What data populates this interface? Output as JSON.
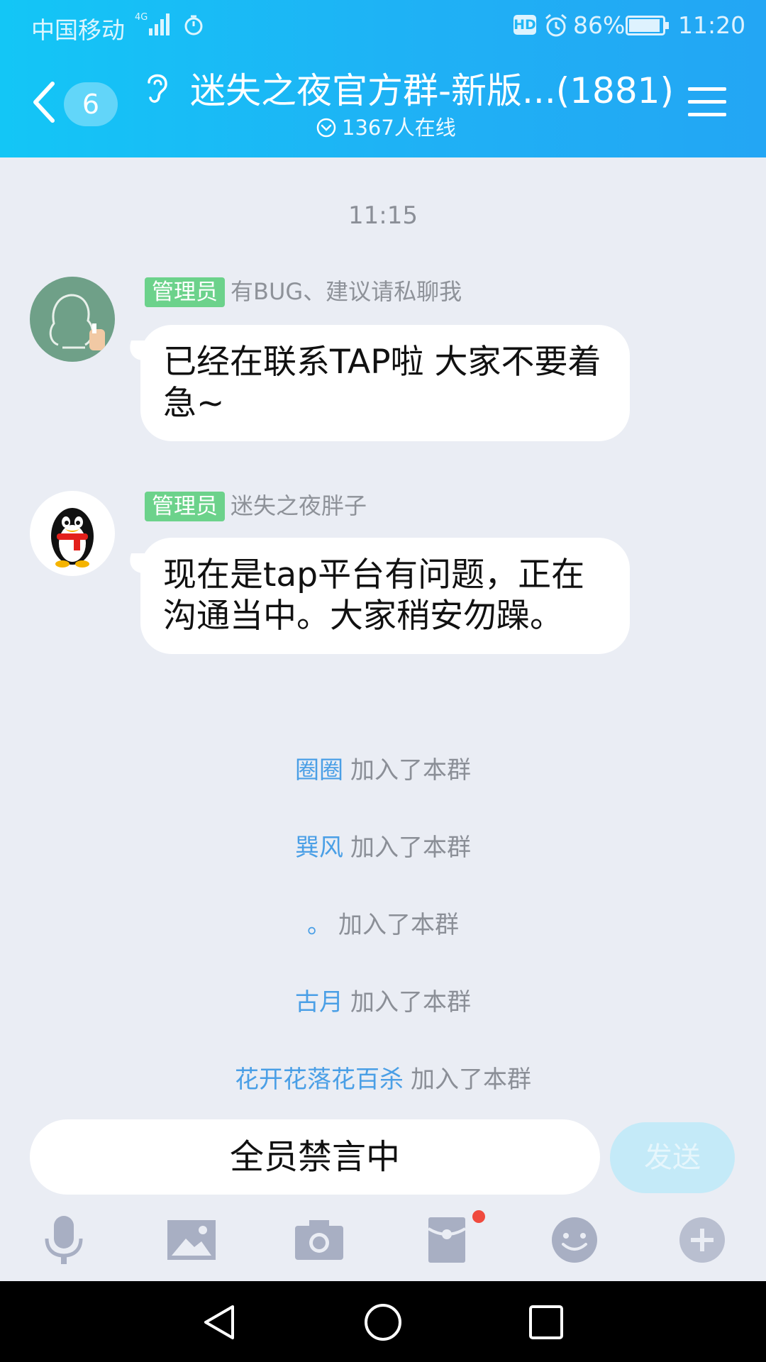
{
  "status_bar": {
    "carrier": "中国移动",
    "network": "4G",
    "hd": "HD",
    "battery": "86%",
    "time": "11:20"
  },
  "header": {
    "unread_count": "6",
    "title": "迷失之夜官方群-新版...(1881)",
    "online": "1367人在线"
  },
  "chat": {
    "timestamp": "11:15",
    "messages": [
      {
        "role": "管理员",
        "sender": "有BUG、建议请私聊我",
        "text": "已经在联系TAP啦 大家不要着急~"
      },
      {
        "role": "管理员",
        "sender": "迷失之夜胖子",
        "text": "现在是tap平台有问题，正在沟通当中。大家稍安勿躁。"
      }
    ],
    "joins": [
      {
        "name": "圈圈",
        "action": "加入了本群"
      },
      {
        "name": "巽风",
        "action": "加入了本群"
      },
      {
        "name": "。",
        "action": "加入了本群"
      },
      {
        "name": "古月",
        "action": "加入了本群"
      },
      {
        "name": "花开花落花百杀",
        "action": "加入了本群"
      }
    ]
  },
  "input": {
    "status": "全员禁言中",
    "send_label": "发送"
  },
  "toolbar": {
    "icons": [
      "microphone-icon",
      "image-icon",
      "camera-icon",
      "red-packet-icon",
      "emoji-icon",
      "plus-icon"
    ],
    "red_packet_has_notification": true
  },
  "colors": {
    "header": "#1fb6f5",
    "admin_badge": "#6cd28b",
    "join_name": "#4a9fe6",
    "background": "#eaedf4"
  }
}
